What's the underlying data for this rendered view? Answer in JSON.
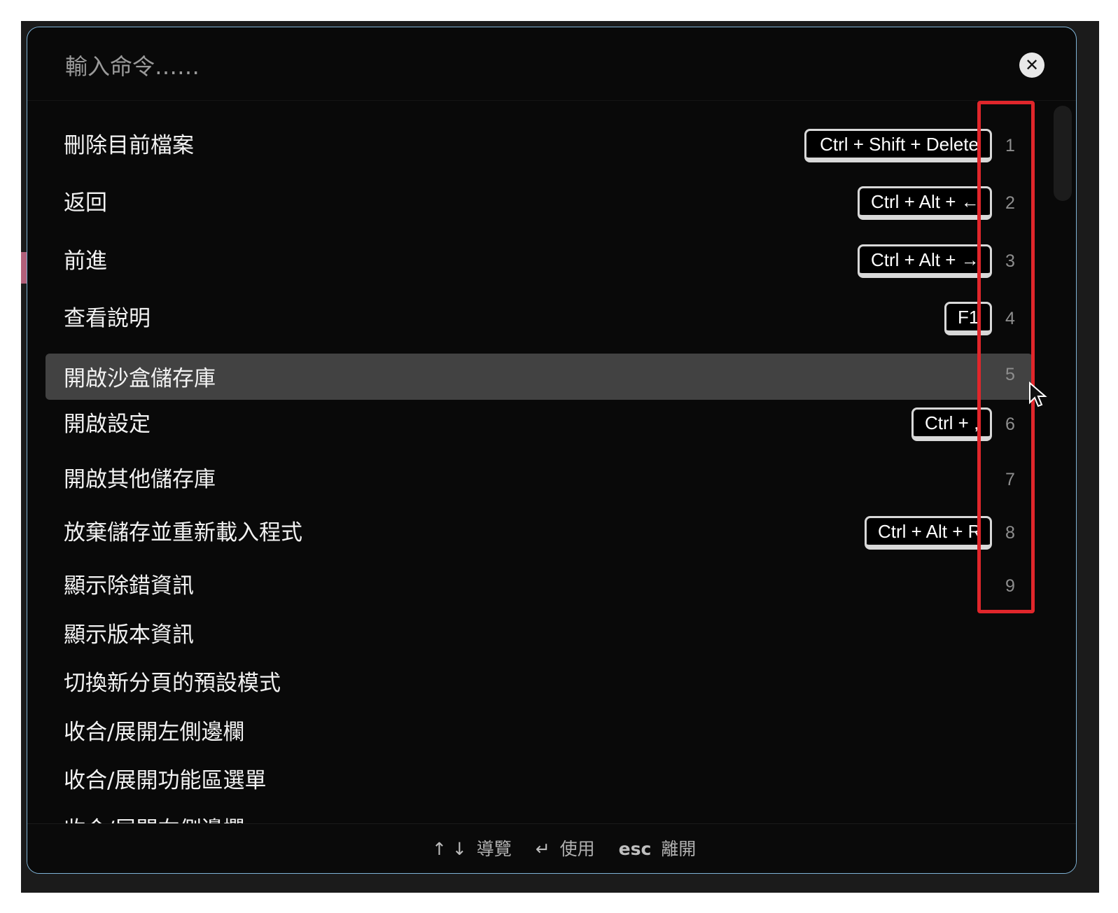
{
  "search": {
    "placeholder": "輸入命令……",
    "value": ""
  },
  "close_icon": "close-icon",
  "commands": [
    {
      "label": "刪除目前檔案",
      "shortcut": "Ctrl + Shift + Delete",
      "number": "1"
    },
    {
      "label": "返回",
      "shortcut": "Ctrl + Alt + ←",
      "number": "2"
    },
    {
      "label": "前進",
      "shortcut": "Ctrl + Alt + →",
      "number": "3"
    },
    {
      "label": "查看說明",
      "shortcut": "F1",
      "number": "4"
    },
    {
      "label": "開啟沙盒儲存庫",
      "shortcut": "",
      "number": "5",
      "selected": true
    },
    {
      "label": "開啟設定",
      "shortcut": "Ctrl + ,",
      "number": "6"
    },
    {
      "label": "開啟其他儲存庫",
      "shortcut": "",
      "number": "7"
    },
    {
      "label": "放棄儲存並重新載入程式",
      "shortcut": "Ctrl + Alt + R",
      "number": "8"
    },
    {
      "label": "顯示除錯資訊",
      "shortcut": "",
      "number": "9"
    },
    {
      "label": "顯示版本資訊",
      "shortcut": "",
      "number": ""
    },
    {
      "label": "切換新分頁的預設模式",
      "shortcut": "",
      "number": ""
    },
    {
      "label": "收合/展開左側邊欄",
      "shortcut": "",
      "number": ""
    },
    {
      "label": "收合/展開功能區選單",
      "shortcut": "",
      "number": ""
    },
    {
      "label": "收合/展開右側邊欄",
      "shortcut": "",
      "number": ""
    }
  ],
  "footer": {
    "navigate_keys": "↑ ↓",
    "navigate_label": "導覽",
    "use_key": "↵",
    "use_label": "使用",
    "esc_key": "esc",
    "esc_label": "離開"
  },
  "colors": {
    "modal_bg": "#090909",
    "modal_border": "#7fb3d6",
    "selected_row": "#424242",
    "annotation_box": "#e0262b"
  }
}
